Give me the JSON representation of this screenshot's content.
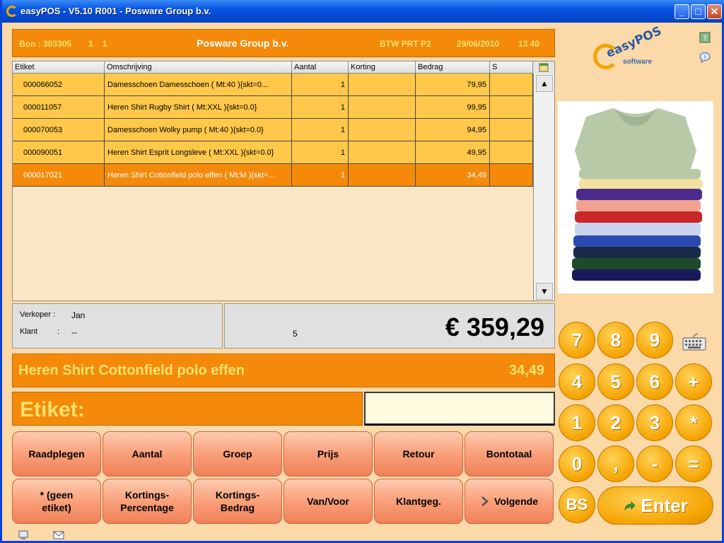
{
  "window": {
    "title": "easyPOS - V5.10 R001 - Posware Group b.v.",
    "minimize": "_",
    "maximize": "□",
    "close": "✕"
  },
  "header": {
    "bon_label": "Bon :",
    "bon_number": "303305",
    "field_a": "1",
    "field_b": "1",
    "company": "Posware Group b.v.",
    "btw": "BTW PRT P2",
    "date": "29/06/2010",
    "time": "13 40"
  },
  "grid": {
    "columns": [
      "Etiket",
      "Omschrijving",
      "Aantal",
      "Korting",
      "Bedrag",
      "S"
    ],
    "rows": [
      {
        "etiket": "000066052",
        "omschrijving": "Damesschoen Damesschoen  ( Mt:40 ){skt=0...",
        "aantal": "1",
        "korting": "",
        "bedrag": "79,95",
        "s": ""
      },
      {
        "etiket": "000011057",
        "omschrijving": "Heren Shirt Rugby Shirt  ( Mt:XXL ){skt=0.0}",
        "aantal": "1",
        "korting": "",
        "bedrag": "99,95",
        "s": ""
      },
      {
        "etiket": "000070053",
        "omschrijving": "Damesschoen Wolky pump  ( Mt:40 ){skt=0.0}",
        "aantal": "1",
        "korting": "",
        "bedrag": "94,95",
        "s": ""
      },
      {
        "etiket": "000090051",
        "omschrijving": "Heren Shirt Esprit Longsleve  ( Mt:XXL ){skt=0.0}",
        "aantal": "1",
        "korting": "",
        "bedrag": "49,95",
        "s": ""
      },
      {
        "etiket": "000017021",
        "omschrijving": "Heren Shirt Cottonfield polo effen  ( Mt:M ){skt=...",
        "aantal": "1",
        "korting": "",
        "bedrag": "34,49",
        "s": ""
      }
    ],
    "scroll_up": "▲",
    "scroll_down": "▼"
  },
  "info": {
    "verkoper_label": "Verkoper :",
    "verkoper_value": "Jan",
    "klant_label": "Klant",
    "klant_colon": ":",
    "klant_value": "--",
    "item_count": "5",
    "total": "€ 359,29"
  },
  "current_item": {
    "description": "Heren Shirt Cottonfield polo effen",
    "price": "34,49"
  },
  "etiket": {
    "label": "Etiket:",
    "value": ""
  },
  "function_buttons": {
    "row1": [
      "Raadplegen",
      "Aantal",
      "Groep",
      "Prijs",
      "Retour",
      "Bontotaal"
    ],
    "row2": [
      "* (geen etiket)",
      "Kortings-Percentage",
      "Kortings-Bedrag",
      "Van/Voor",
      "Klantgeg.",
      "Volgende"
    ]
  },
  "logo": {
    "name": "easyPOS",
    "sub": "software"
  },
  "keypad": {
    "keys": [
      "7",
      "8",
      "9",
      "4",
      "5",
      "6",
      "+",
      "1",
      "2",
      "3",
      "*",
      "0",
      ",",
      "-",
      "=",
      "BS"
    ],
    "enter": "Enter"
  },
  "colors": {
    "accent_orange": "#f58a0a",
    "header_text": "#ffe26b",
    "row_fill": "#ffc84a",
    "background": "#fcd9a8"
  }
}
